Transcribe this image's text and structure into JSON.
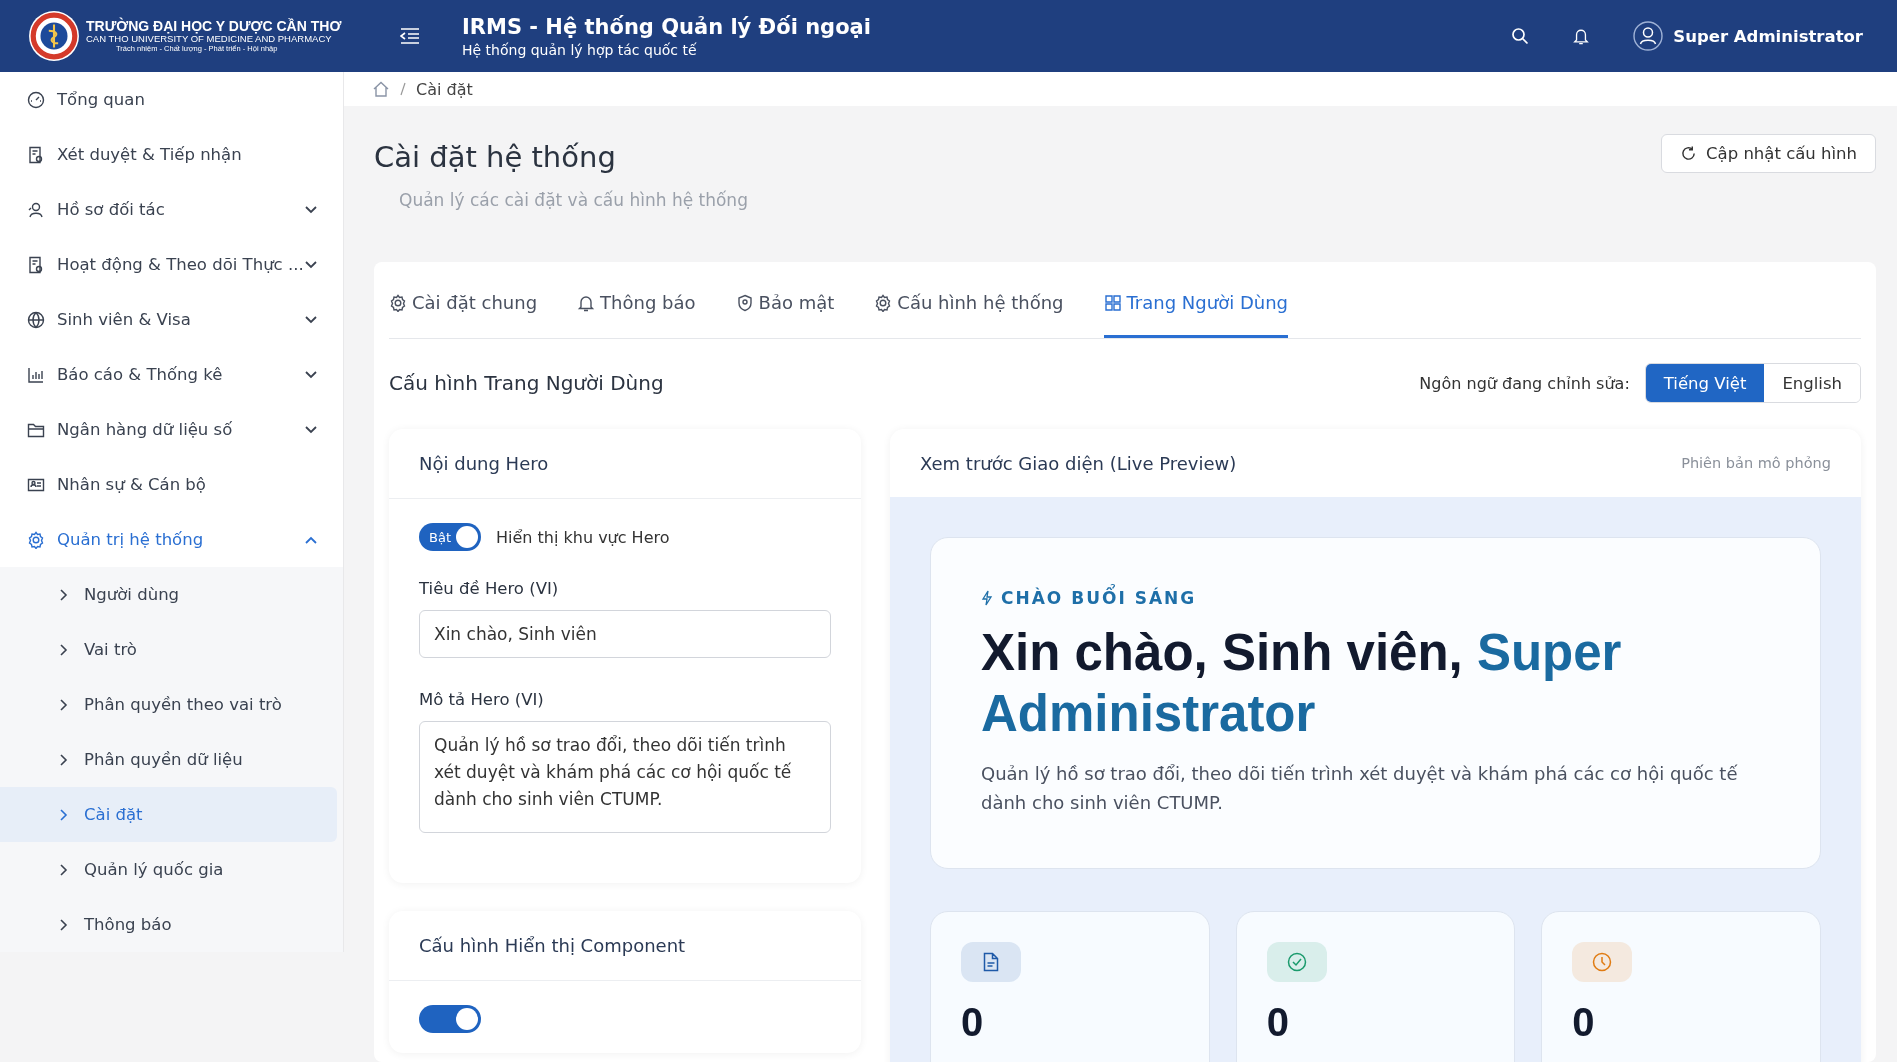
{
  "header": {
    "logo_lines": [
      "TRƯỜNG ĐẠI HỌC Y DƯỢC CẦN THƠ",
      "CAN THO UNIVERSITY OF MEDICINE AND PHARMACY",
      "Trách nhiệm - Chất lượng - Phát triển - Hội nhập"
    ],
    "title": "IRMS - Hệ thống Quản lý Đối ngoại",
    "subtitle": "Hệ thống quản lý hợp tác quốc tế",
    "user": "Super Administrator"
  },
  "sidebar": {
    "items": [
      {
        "label": "Tổng quan",
        "expandable": false,
        "selected": false
      },
      {
        "label": "Xét duyệt & Tiếp nhận",
        "expandable": false,
        "selected": false
      },
      {
        "label": "Hồ sơ đối tác",
        "expandable": true,
        "expanded": false,
        "selected": false
      },
      {
        "label": "Hoạt động & Theo dõi Thực ...",
        "expandable": true,
        "expanded": false,
        "selected": false
      },
      {
        "label": "Sinh viên & Visa",
        "expandable": true,
        "expanded": false,
        "selected": false
      },
      {
        "label": "Báo cáo & Thống kê",
        "expandable": true,
        "expanded": false,
        "selected": false
      },
      {
        "label": "Ngân hàng dữ liệu số",
        "expandable": true,
        "expanded": false,
        "selected": false
      },
      {
        "label": "Nhân sự & Cán bộ",
        "expandable": false,
        "selected": false
      },
      {
        "label": "Quản trị hệ thống",
        "expandable": true,
        "expanded": true,
        "selected": true,
        "children": [
          {
            "label": "Người dùng",
            "selected": false
          },
          {
            "label": "Vai trò",
            "selected": false
          },
          {
            "label": "Phân quyền theo vai trò",
            "selected": false
          },
          {
            "label": "Phân quyền dữ liệu",
            "selected": false
          },
          {
            "label": "Cài đặt",
            "selected": true
          },
          {
            "label": "Quản lý quốc gia",
            "selected": false
          },
          {
            "label": "Thông báo",
            "selected": false
          }
        ]
      }
    ]
  },
  "breadcrumb": [
    "Cài đặt"
  ],
  "page": {
    "title": "Cài đặt hệ thống",
    "subtitle": "Quản lý các cài đặt và cấu hình hệ thống",
    "refresh_button": "Cập nhật cấu hình"
  },
  "tabs": [
    {
      "label": "Cài đặt chung",
      "selected": false
    },
    {
      "label": "Thông báo",
      "selected": false
    },
    {
      "label": "Bảo mật",
      "selected": false
    },
    {
      "label": "Cấu hình hệ thống",
      "selected": false
    },
    {
      "label": "Trang Người Dùng",
      "selected": true
    }
  ],
  "section": {
    "title": "Cấu hình Trang Người Dùng",
    "language_label": "Ngôn ngữ đang chỉnh sửa:",
    "languages": [
      {
        "label": "Tiếng Việt",
        "selected": true
      },
      {
        "label": "English",
        "selected": false
      }
    ]
  },
  "hero_card": {
    "title": "Nội dung Hero",
    "toggle": {
      "on": true,
      "state_text": "Bật",
      "label": "Hiển thị khu vực Hero"
    },
    "title_field": {
      "label": "Tiêu đề Hero (VI)",
      "value": "Xin chào, Sinh viên"
    },
    "description_field": {
      "label": "Mô tả Hero (VI)",
      "value": "Quản lý hồ sơ trao đổi, theo dõi tiến trình xét duyệt và khám phá các cơ hội quốc tế dành cho sinh viên CTUMP."
    }
  },
  "component_card": {
    "title": "Cấu hình Hiển thị Component",
    "toggle": {
      "on": true
    }
  },
  "preview": {
    "title": "Xem trước Giao diện (Live Preview)",
    "badge": "Phiên bản mô phỏng",
    "greeting": "CHÀO BUỔI SÁNG",
    "heading": "Xin chào, Sinh viên,",
    "heading_name": "Super Administrator",
    "description": "Quản lý hồ sơ trao đổi, theo dõi tiến trình xét duyệt và khám phá các cơ hội quốc tế dành cho sinh viên CTUMP.",
    "stats": [
      {
        "kind": "document",
        "color": "#1e5aa8",
        "value": "0"
      },
      {
        "kind": "check",
        "color": "#1a9a6c",
        "value": "0"
      },
      {
        "kind": "clock",
        "color": "#e07b12",
        "value": "0"
      }
    ]
  }
}
